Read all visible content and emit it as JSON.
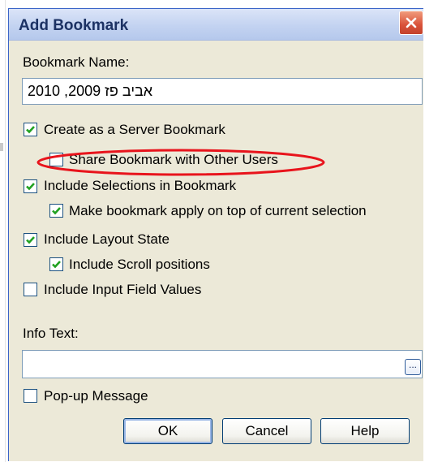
{
  "dialog": {
    "title": "Add Bookmark",
    "close_icon": "close-x-icon"
  },
  "bookmark_name": {
    "label": "Bookmark Name:",
    "value": "אביב פז 2009, 2010"
  },
  "checkboxes": [
    {
      "id": "server-bookmark",
      "label": "Create as a Server Bookmark",
      "checked": true
    },
    {
      "id": "share-bookmark",
      "label": "Share Bookmark with Other Users",
      "checked": false
    },
    {
      "id": "include-selections",
      "label": "Include Selections in Bookmark",
      "checked": true
    },
    {
      "id": "apply-on-top",
      "label": "Make bookmark apply on top of current selection",
      "checked": true
    },
    {
      "id": "include-layout",
      "label": "Include Layout State",
      "checked": true
    },
    {
      "id": "include-scroll",
      "label": "Include Scroll positions",
      "checked": true
    },
    {
      "id": "include-input-fields",
      "label": "Include Input Field Values",
      "checked": false
    }
  ],
  "info_text": {
    "label": "Info Text:",
    "value": "",
    "browse_label": "..."
  },
  "popup": {
    "label": "Pop-up Message",
    "checked": false
  },
  "buttons": {
    "ok": "OK",
    "cancel": "Cancel",
    "help": "Help"
  },
  "annotation": {
    "color": "#e8141c",
    "shape": "ellipse"
  },
  "colors": {
    "title_bar": "#c3d3f1",
    "dialog_bg": "#ece9d8",
    "close_button": "#d9523a",
    "check_mark": "#21a121"
  }
}
